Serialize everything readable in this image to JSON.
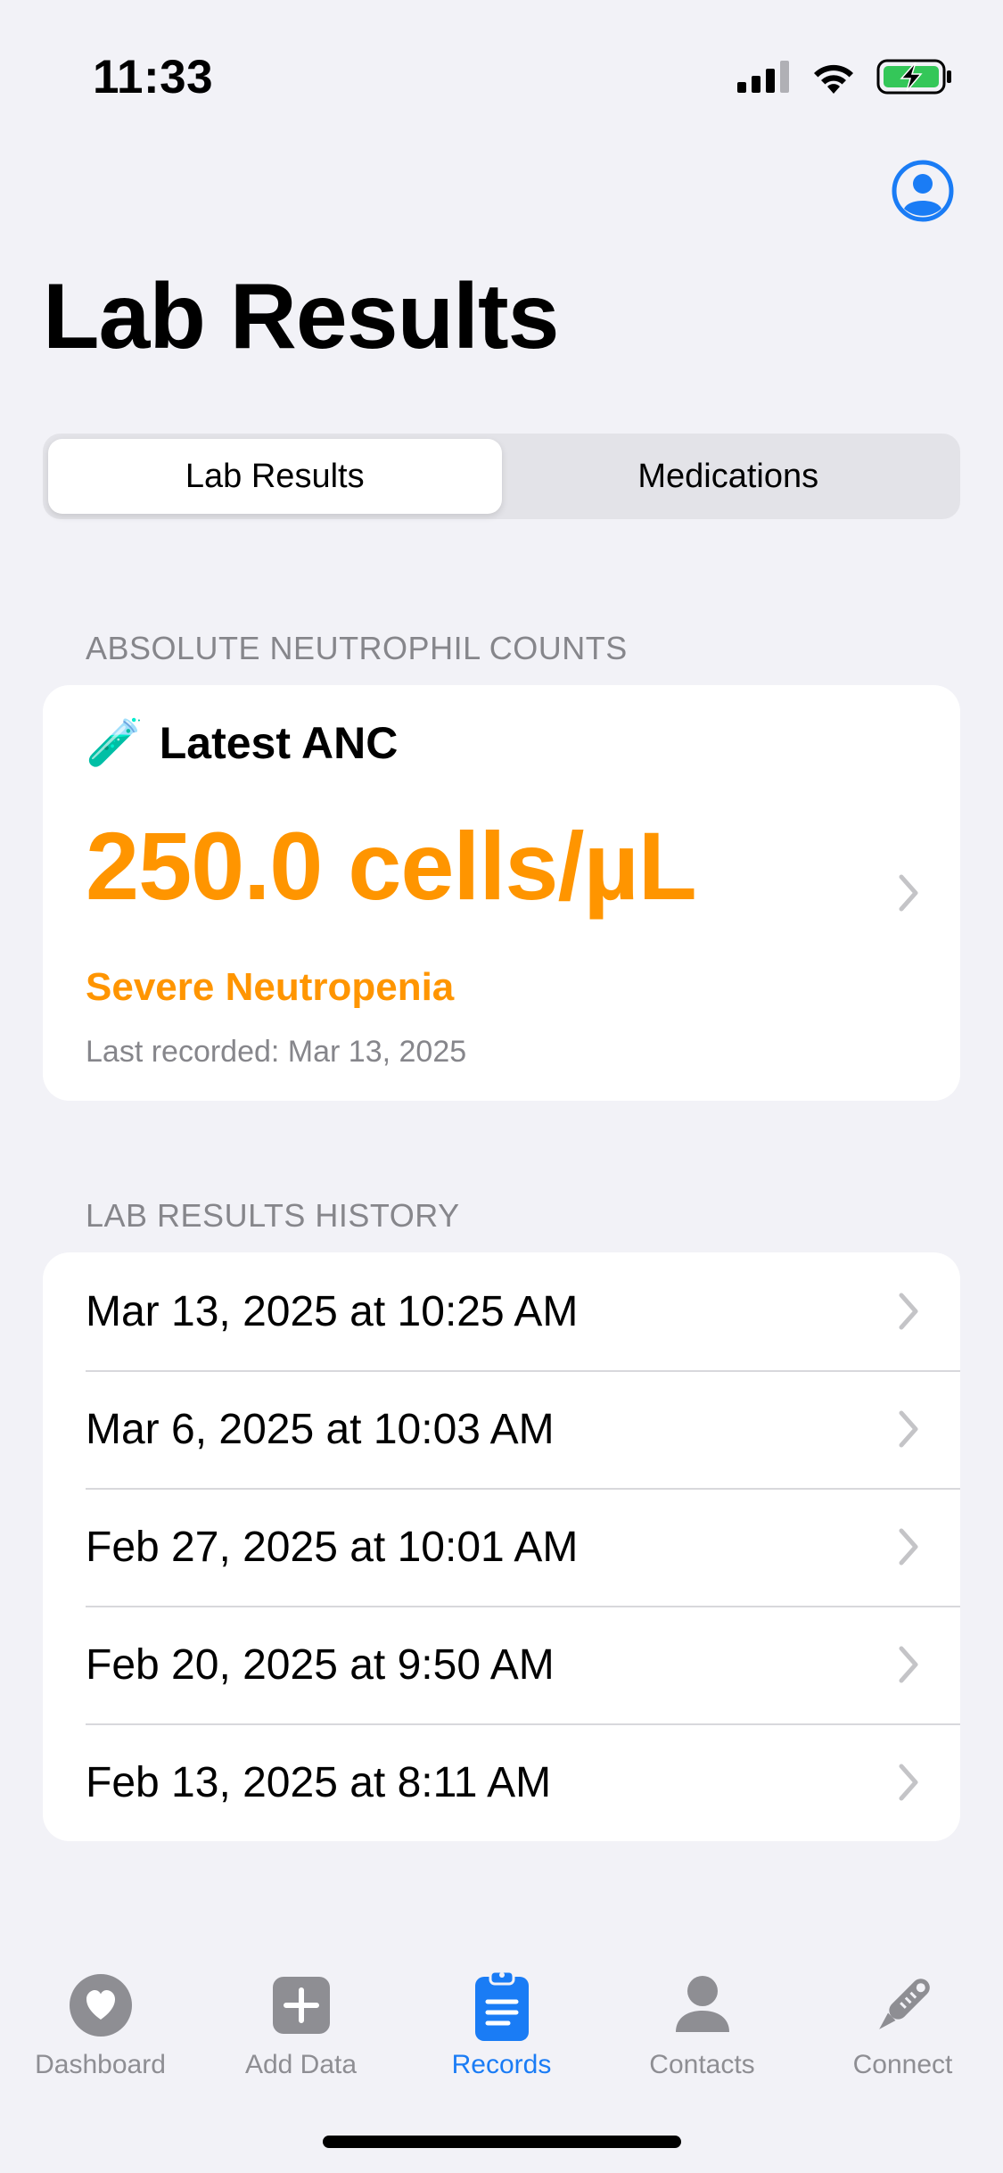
{
  "status_bar": {
    "time": "11:33",
    "icons": [
      "cellular-signal-icon",
      "wifi-icon",
      "battery-charging-icon"
    ]
  },
  "header": {
    "title": "Lab Results",
    "profile_icon": "person-circle-icon"
  },
  "segmented_control": {
    "segments": [
      {
        "label": "Lab Results",
        "selected": true
      },
      {
        "label": "Medications",
        "selected": false
      }
    ]
  },
  "anc_section": {
    "header": "ABSOLUTE NEUTROPHIL COUNTS",
    "card": {
      "emoji": "🧪",
      "title": "Latest ANC",
      "value": "250.0 cells/µL",
      "status": "Severe Neutropenia",
      "last_recorded": "Last recorded: Mar 13, 2025"
    }
  },
  "history_section": {
    "header": "LAB RESULTS HISTORY",
    "rows": [
      "Mar 13, 2025 at 10:25 AM",
      "Mar 6, 2025 at 10:03 AM",
      "Feb 27, 2025 at 10:01 AM",
      "Feb 20, 2025 at 9:50 AM",
      "Feb 13, 2025 at 8:11 AM"
    ]
  },
  "tab_bar": {
    "tabs": [
      {
        "label": "Dashboard",
        "icon": "heart-circle-icon",
        "active": false
      },
      {
        "label": "Add Data",
        "icon": "plus-square-icon",
        "active": false
      },
      {
        "label": "Records",
        "icon": "clipboard-icon",
        "active": true
      },
      {
        "label": "Contacts",
        "icon": "person-icon",
        "active": false
      },
      {
        "label": "Connect",
        "icon": "thermometer-icon",
        "active": false
      }
    ]
  },
  "colors": {
    "accent": "#1a7cf5",
    "warning": "#ff9500",
    "background": "#f2f2f7",
    "secondary_text": "#86868b"
  }
}
